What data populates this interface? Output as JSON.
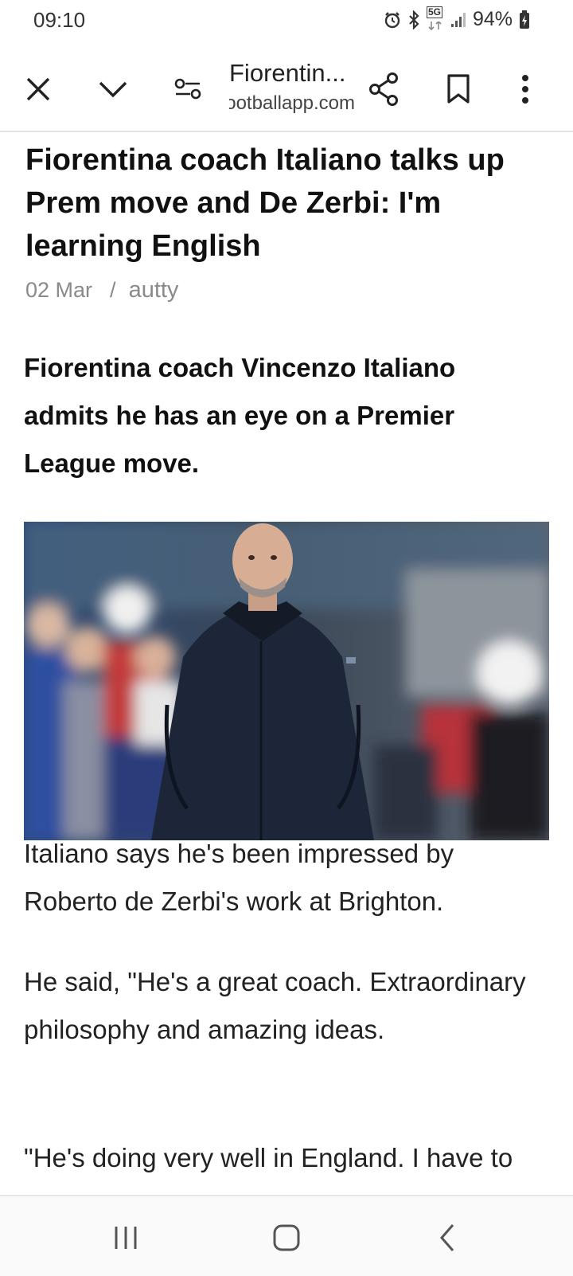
{
  "status_bar": {
    "time": "09:10",
    "network": "5G",
    "battery": "94%"
  },
  "toolbar": {
    "page_title": "Fiorentin...",
    "page_domain": "footballapp.com",
    "icons": [
      "close-icon",
      "chevron-down-icon",
      "page-settings-icon",
      "share-icon",
      "bookmark-icon",
      "more-vert-icon"
    ]
  },
  "article": {
    "headline": "Fiorentina coach Italiano talks up Prem move and De Zerbi: I'm learning English",
    "date": "02 Mar",
    "separator": "/",
    "author": "autty",
    "lead": "Fiorentina coach Vincenzo Italiano admits he has an eye on a Premier League move.",
    "paragraphs": [
      "Italiano says he's been impressed by Roberto de Zerbi's work at Brighton.",
      "He said, \"He's a great coach. Extraordinary philosophy and amazing ideas.",
      "\"He's doing very well in England. I have to"
    ]
  },
  "nav_bar": {
    "icons": [
      "recent-apps-icon",
      "home-icon",
      "back-icon"
    ]
  },
  "colors": {
    "meta_text": "#8a8a8a",
    "divider": "#e3e3e3"
  }
}
